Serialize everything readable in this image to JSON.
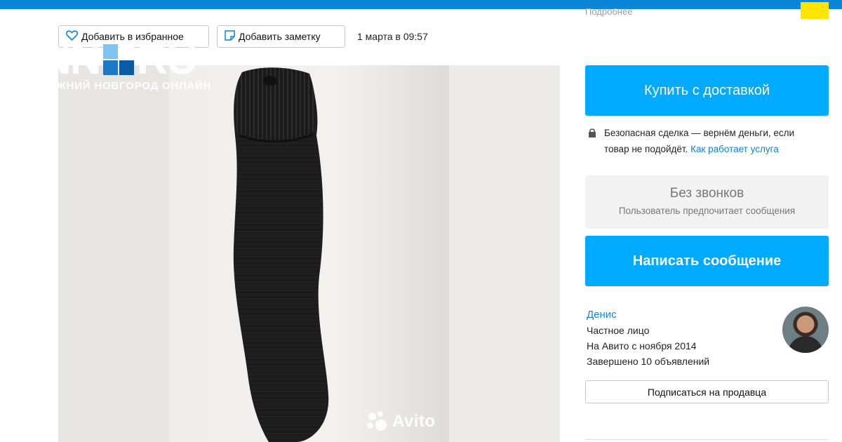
{
  "header": {
    "more_link": "Подробнее"
  },
  "actions": {
    "favorite_label": "Добавить в избранное",
    "note_label": "Добавить заметку",
    "date": "1 марта в 09:57"
  },
  "photo": {
    "watermark": "Avito"
  },
  "logo": {
    "nn": "NN",
    "ru": "RU",
    "subtitle": "НИЖНИЙ НОВГОРОД ОНЛАЙН"
  },
  "sidebar": {
    "buy_button": "Купить с доставкой",
    "safe_deal_text": "Безопасная сделка — вернём деньги, если",
    "safe_deal_text2": "товар не подойдёт.",
    "safe_deal_link": "Как работает услуга",
    "no_calls_title": "Без звонков",
    "no_calls_sub": "Пользователь предпочитает сообщения",
    "message_button": "Написать сообщение",
    "seller": {
      "name": "Денис",
      "type": "Частное лицо",
      "since": "На Авито с ноября 2014",
      "completed": "Завершено 10 объявлений"
    },
    "subscribe_button": "Подписаться на продавца"
  },
  "colors": {
    "topbar": "#0a86d9",
    "primary_button": "#00aaff",
    "link": "#0a86d9",
    "highlight": "#ffe400"
  },
  "icons": [
    "heart-icon",
    "note-icon",
    "lock-icon",
    "avito-logo-icon",
    "nn-logo-icon"
  ]
}
